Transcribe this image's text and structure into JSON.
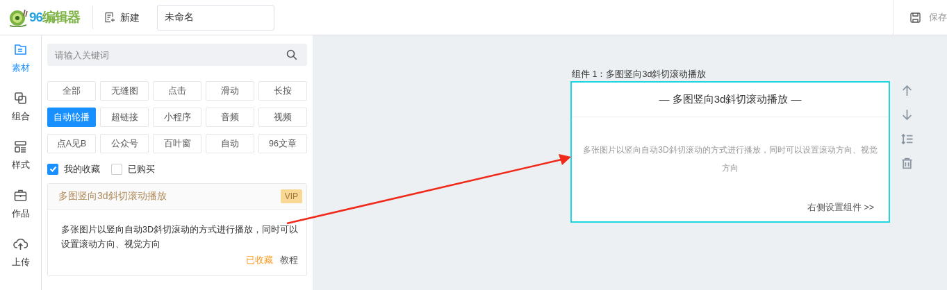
{
  "header": {
    "logo": {
      "number": "96",
      "name": "编辑器"
    },
    "new_button": "新建",
    "title_field": {
      "value": "未命名"
    },
    "save_button": "保存"
  },
  "nav": [
    {
      "label": "素材",
      "selected": true
    },
    {
      "label": "组合",
      "selected": false
    },
    {
      "label": "样式",
      "selected": false
    },
    {
      "label": "作品",
      "selected": false
    },
    {
      "label": "上传",
      "selected": false
    }
  ],
  "search": {
    "placeholder": "请输入关键词"
  },
  "tags": [
    {
      "label": "全部",
      "selected": false
    },
    {
      "label": "无缝图",
      "selected": false
    },
    {
      "label": "点击",
      "selected": false
    },
    {
      "label": "滑动",
      "selected": false
    },
    {
      "label": "长按",
      "selected": false
    },
    {
      "label": "自动轮播",
      "selected": true
    },
    {
      "label": "超链接",
      "selected": false
    },
    {
      "label": "小程序",
      "selected": false
    },
    {
      "label": "音频",
      "selected": false
    },
    {
      "label": "视频",
      "selected": false
    },
    {
      "label": "点A见B",
      "selected": false
    },
    {
      "label": "公众号",
      "selected": false
    },
    {
      "label": "百叶窗",
      "selected": false
    },
    {
      "label": "自动",
      "selected": false
    },
    {
      "label": "96文章",
      "selected": false
    }
  ],
  "filters": [
    {
      "label": "我的收藏",
      "checked": true
    },
    {
      "label": "已购买",
      "checked": false
    }
  ],
  "material_card": {
    "title": "多图竖向3d斜切滚动播放",
    "badge": "VIP",
    "description": "多张图片以竖向自动3D斜切滚动的方式进行播放，同时可以设置滚动方向、视觉方向",
    "favorite": "已收藏",
    "tutorial": "教程"
  },
  "component": {
    "label": "组件 1：多图竖向3d斜切滚动播放",
    "heading": "— 多图竖向3d斜切滚动播放 —",
    "description": "多张图片以竖向自动3D斜切滚动的方式进行播放，同时可以设置滚动方向、视觉方向",
    "settings_link": "右侧设置组件 >>"
  }
}
